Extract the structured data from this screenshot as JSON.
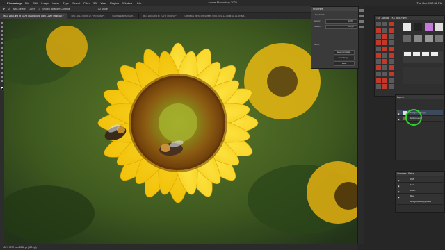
{
  "menubar": {
    "app": "Photoshop",
    "items": [
      "File",
      "Edit",
      "Image",
      "Layer",
      "Type",
      "Select",
      "Filter",
      "3D",
      "View",
      "Plugins",
      "Window",
      "Help"
    ],
    "clock": "Thu Dec 9  12:58 PM"
  },
  "app_title": "Adobe Photoshop 2022",
  "options": {
    "auto_select": "Auto-Select:",
    "layer_value": "Layer",
    "show_transform": "Show Transform Controls",
    "mode_3d": "3D Mode:"
  },
  "tabs": [
    {
      "label": "IMG_1603.dng @ 100% (Background copy, Layer Mask/16) *",
      "active": true
    },
    {
      "label": "IMG_1512.jpg @ 17.7% (RGB/8*)",
      "active": false
    },
    {
      "label": "Color galaxies TR2m...",
      "active": false
    },
    {
      "label": "IMG_1553.dng @ 100% (RGB/16*)",
      "active": false
    },
    {
      "label": "Untitled-1 @ 91.9% Screen Shot 2021-12-08 at 10.36.49 AM...",
      "active": false
    }
  ],
  "status": "100%   3072 px x 2048 px (300 ppi)",
  "properties": {
    "title": "Properties",
    "section": "Layer Mask",
    "density_label": "Density:",
    "density_value": "100%",
    "feather_label": "Feather:",
    "feather_value": "0.0 px",
    "refine_label": "Refine:",
    "select_mask": "Select and Mask...",
    "color_range": "Color Range...",
    "invert": "Invert"
  },
  "panels": {
    "tabs_top": [
      "TDI",
      "Actions",
      "TKS Multi-Panel"
    ],
    "layers_title": "Layers",
    "channels_title": "Channels",
    "paths_title": "Paths",
    "layers": [
      {
        "name": "Background copy",
        "visible": true
      },
      {
        "name": "Background",
        "visible": true
      }
    ],
    "channels": [
      {
        "name": "RGB"
      },
      {
        "name": "Red"
      },
      {
        "name": "Green"
      },
      {
        "name": "Blue"
      },
      {
        "name": "Background copy Mask"
      }
    ],
    "colors": {
      "tile_red": "#c0392b",
      "tile_gray": "#5a5a5a",
      "highlight": "#2ed22e"
    }
  }
}
